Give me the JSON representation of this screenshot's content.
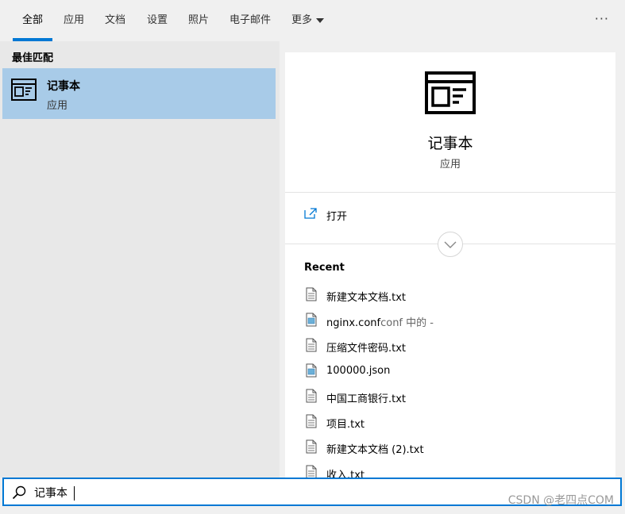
{
  "tabs": [
    {
      "label": "全部",
      "active": true
    },
    {
      "label": "应用"
    },
    {
      "label": "文档"
    },
    {
      "label": "设置"
    },
    {
      "label": "照片"
    },
    {
      "label": "电子邮件"
    },
    {
      "label": "更多"
    }
  ],
  "more_menu_icon": "ellipsis-icon",
  "left": {
    "heading": "最佳匹配",
    "result": {
      "title": "记事本",
      "subtitle": "应用",
      "icon": "notepad-icon"
    }
  },
  "right": {
    "app_title": "记事本",
    "app_subtitle": "应用",
    "open_label": "打开",
    "recent_heading": "Recent",
    "recent_items": [
      {
        "name": "新建文本文档.txt",
        "suffix": "",
        "icon": "text-file-icon"
      },
      {
        "name": "nginx.conf",
        "suffix": "conf 中的 -",
        "icon": "config-file-icon"
      },
      {
        "name": "压缩文件密码.txt",
        "suffix": "",
        "icon": "text-file-icon"
      },
      {
        "name": "100000.json",
        "suffix": "",
        "icon": "config-file-icon"
      },
      {
        "name": "中国工商银行.txt",
        "suffix": "",
        "icon": "text-file-icon"
      },
      {
        "name": "项目.txt",
        "suffix": "",
        "icon": "text-file-icon"
      },
      {
        "name": "新建文本文档 (2).txt",
        "suffix": "",
        "icon": "text-file-icon"
      },
      {
        "name": "收入.txt",
        "suffix": "",
        "icon": "text-file-icon"
      }
    ]
  },
  "search": {
    "value": "记事本"
  },
  "watermark": "CSDN @老四点COM",
  "colors": {
    "accent": "#0078d4",
    "selected": "#a8cbe8"
  }
}
